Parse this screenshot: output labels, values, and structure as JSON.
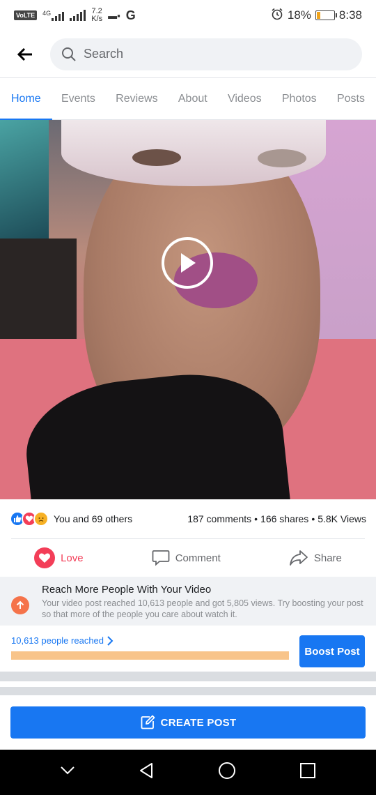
{
  "status_bar": {
    "volte": "VoLTE",
    "network": "4G",
    "speed_value": "7.2",
    "speed_unit": "K/s",
    "carrier_letter": "G",
    "battery_percent": "18%",
    "battery_level": 0.18,
    "time": "8:38"
  },
  "header": {
    "search_placeholder": "Search"
  },
  "tabs": [
    "Home",
    "Events",
    "Reviews",
    "About",
    "Videos",
    "Photos",
    "Posts"
  ],
  "active_tab": "Home",
  "post": {
    "reactions_text": "You and 69 others",
    "comments": "187 comments",
    "shares": "166 shares",
    "views": "5.8K Views",
    "dot": "•",
    "actions": {
      "love": "Love",
      "comment": "Comment",
      "share": "Share"
    }
  },
  "reach": {
    "title": "Reach More People With Your Video",
    "description": "Your video post reached 10,613 people and got 5,805 views. Try boosting your post so that more of the people you care about watch it.",
    "people_reached": "10,613 people reached",
    "boost_label": "Boost Post"
  },
  "create_post_label": "CREATE POST",
  "colors": {
    "accent": "#1877f2",
    "love": "#f33e58",
    "reach_icon": "#f5734a",
    "progress": "#f5c68e"
  }
}
